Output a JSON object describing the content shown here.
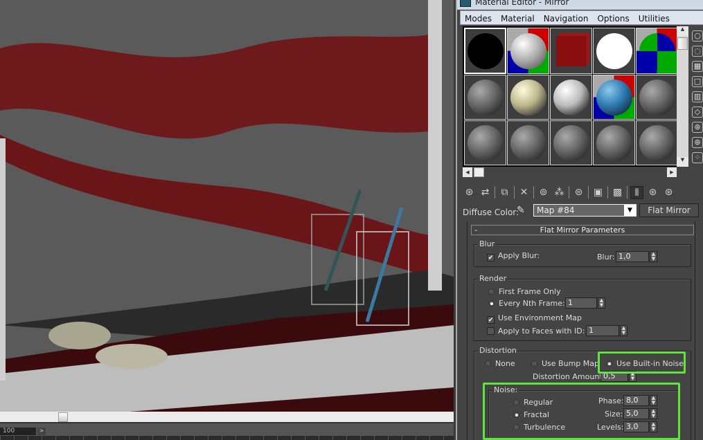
{
  "viewport": {
    "frame_value": "100",
    "frame_button": ">"
  },
  "editor": {
    "title": "Material Editor - Mirror",
    "menu": [
      "Modes",
      "Material",
      "Navigation",
      "Options",
      "Utilities"
    ],
    "diffuse_label": "Diffuse Color:",
    "map_name": "Map #84",
    "map_type": "Flat Mirror",
    "rollout_title": "Flat Mirror Parameters",
    "rollout_toggle": "-",
    "blur": {
      "label": "Blur",
      "apply_blur": "Apply Blur:",
      "apply_checked": true,
      "blur_label": "Blur:",
      "blur_value": "1,0"
    },
    "render": {
      "label": "Render",
      "first_frame": "First Frame Only",
      "every_nth": "Every Nth Frame:",
      "nth_value": "1",
      "use_env": "Use Environment Map",
      "use_env_checked": true,
      "apply_faces": "Apply to Faces with ID:",
      "apply_faces_checked": false,
      "face_id": "1"
    },
    "distortion": {
      "label": "Distortion",
      "none": "None",
      "bump": "Use Bump Map",
      "noise": "Use Built-in Noise",
      "selected": "noise",
      "amount_label": "Distortion Amount:",
      "amount_value": "0,5"
    },
    "noise": {
      "label": "Noise:",
      "regular": "Regular",
      "fractal": "Fractal",
      "turbulence": "Turbulence",
      "selected": "fractal",
      "phase_label": "Phase:",
      "phase": "8,0",
      "size_label": "Size:",
      "size": "5,0",
      "levels_label": "Levels:",
      "levels": "3,0"
    },
    "highlight_color": "#5fe63a"
  }
}
